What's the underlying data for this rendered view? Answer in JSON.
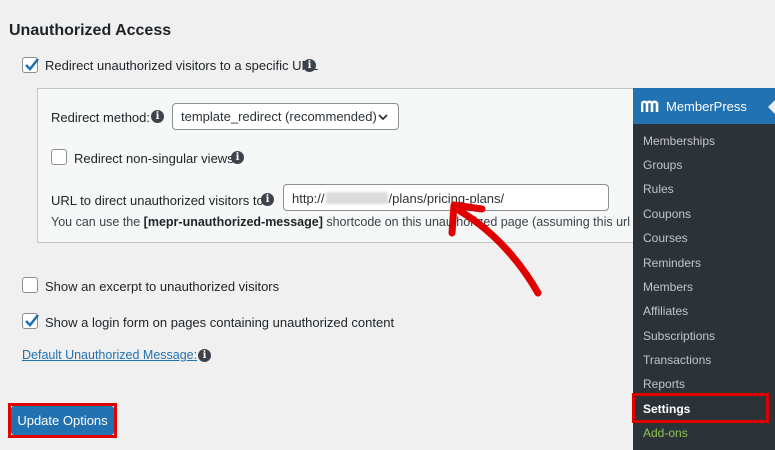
{
  "section": {
    "title": "Unauthorized Access"
  },
  "redirect": {
    "checkbox_label": "Redirect unauthorized visitors to a specific URL",
    "checked": true,
    "method_label": "Redirect method:",
    "method_value": "template_redirect (recommended)",
    "nonsingular_label": "Redirect non-singular views:",
    "url_label": "URL to direct unauthorized visitors to:",
    "url_prefix": "http://",
    "url_suffix": "/plans/pricing-plans/",
    "help_before": "You can use the ",
    "help_shortcode": "[mepr-unauthorized-message]",
    "help_after": " shortcode on this unauthorized page (assuming this url points"
  },
  "excerpt": {
    "label": "Show an excerpt to unauthorized visitors",
    "checked": false
  },
  "login_form": {
    "label": "Show a login form on pages containing unauthorized content",
    "checked": true
  },
  "default_message_link": "Default Unauthorized Message:",
  "update_button": "Update Options",
  "colors": {
    "accent": "#2271b1",
    "highlight": "#e00000",
    "menu_bg": "#2c3338",
    "addon": "#8fc24e"
  },
  "admin_menu": {
    "title": "MemberPress",
    "items": [
      {
        "label": "Memberships"
      },
      {
        "label": "Groups"
      },
      {
        "label": "Rules"
      },
      {
        "label": "Coupons"
      },
      {
        "label": "Courses"
      },
      {
        "label": "Reminders"
      },
      {
        "label": "Members"
      },
      {
        "label": "Affiliates"
      },
      {
        "label": "Subscriptions"
      },
      {
        "label": "Transactions"
      },
      {
        "label": "Reports"
      },
      {
        "label": "Settings"
      },
      {
        "label": "Add-ons"
      }
    ]
  }
}
